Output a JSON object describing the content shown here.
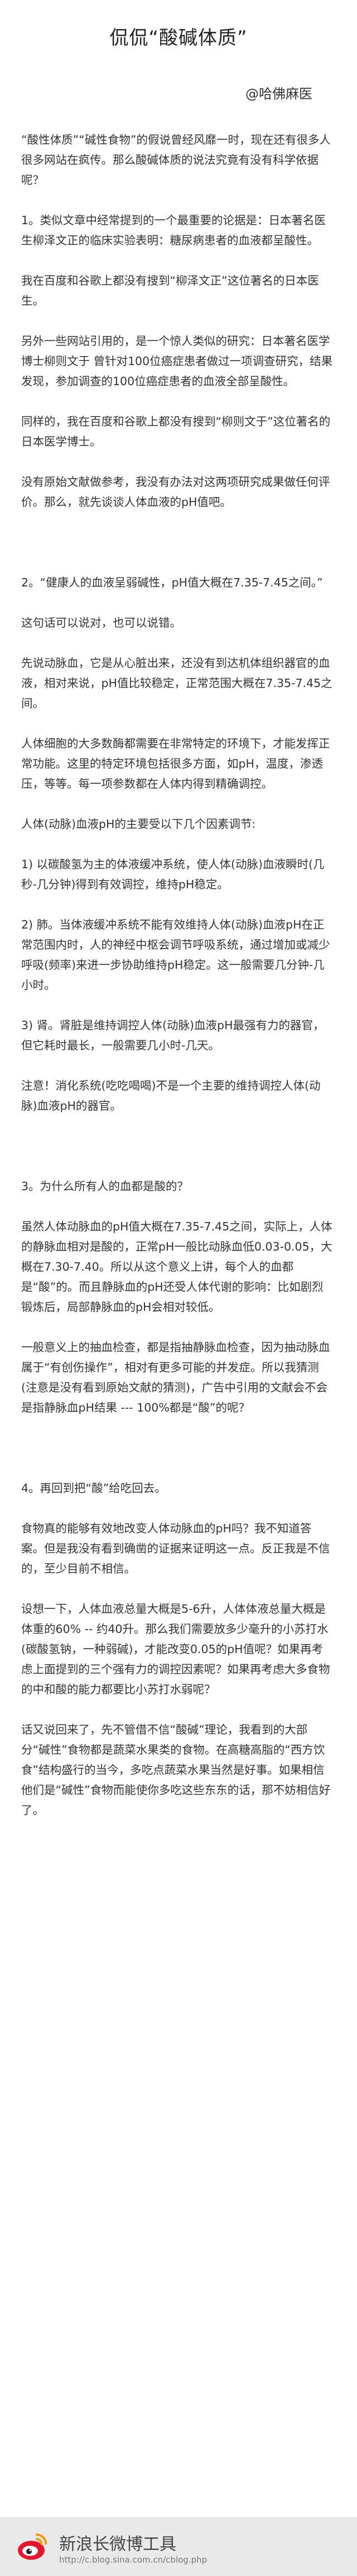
{
  "article": {
    "title": "侃侃“酸碱体质”",
    "author": "@哈佛麻医",
    "paragraphs": [
      "“酸性体质”“碱性食物”的假说曾经风靡一时，现在还有很多人很多网站在疯传。那么酸碱体质的说法究竟有没有科学依据呢？",
      "1。类似文章中经常提到的一个最重要的论据是：日本著名医生柳泽文正的临床实验表明：糖尿病患者的血液都呈酸性。",
      "我在百度和谷歌上都没有搜到“柳泽文正”这位著名的日本医生。",
      "另外一些网站引用的，是一个惊人类似的研究：日本著名医学博士柳则文于 曾针对100位癌症患者做过一项调查研究，结果发现，参加调查的100位癌症患者的血液全部呈酸性。",
      "同样的，我在百度和谷歌上都没有搜到“柳则文于”这位著名的日本医学博士。",
      "没有原始文献做参考，我没有办法对这两项研究成果做任何评价。那么，就先谈谈人体血液的pH值吧。",
      "2。“健康人的血液呈弱碱性，pH值大概在7.35-7.45之间。”",
      "这句话可以说对，也可以说错。",
      "先说动脉血，它是从心脏出来，还没有到达机体组织器官的血液，相对来说，pH值比较稳定，正常范围大概在7.35-7.45之间。",
      "人体细胞的大多数酶都需要在非常特定的环境下，才能发挥正常功能。这里的特定环境包括很多方面，如pH，温度，渗透压，等等。每一项参数都在人体内得到精确调控。",
      "人体(动脉)血液pH的主要受以下几个因素调节:",
      "1) 以碳酸氢为主的体液缓冲系统，使人体(动脉)血液瞬时(几秒-几分钟)得到有效调控，维持pH稳定。",
      "2) 肺。当体液缓冲系统不能有效维持人体(动脉)血液pH在正常范围内时，人的神经中枢会调节呼吸系统，通过增加或减少呼吸(频率)来进一步协助维持pH稳定。这一般需要几分钟-几小时。",
      "3) 肾。肾脏是维持调控人体(动脉)血液pH最强有力的器官，但它耗时最长，一般需要几小时-几天。",
      "注意！消化系统(吃吃喝喝)不是一个主要的维持调控人体(动脉)血液pH的器官。",
      "3。为什么所有人的血都是酸的？",
      "虽然人体动脉血的pH值大概在7.35-7.45之间，实际上，人体的静脉血相对是酸的，正常pH一般比动脉血低0.03-0.05，大概在7.30-7.40。所以从这个意义上讲，每个人的血都是“酸”的。而且静脉血的pH还受人体代谢的影响：比如剧烈锻炼后，局部静脉血的pH会相对较低。",
      "一般意义上的抽血检查，都是指抽静脉血检查，因为抽动脉血属于“有创伤操作”，相对有更多可能的并发症。所以我猜测(注意是没有看到原始文献的猜测)，广告中引用的文献会不会是指静脉血pH结果 --- 100%都是“酸”的呢？",
      "4。再回到把“酸”给吃回去。",
      "食物真的能够有效地改变人体动脉血的pH吗？我不知道答案。但是我没有看到确凿的证据来证明这一点。反正我是不信的，至少目前不相信。",
      "设想一下，人体血液总量大概是5-6升，人体体液总量大概是体重的60% -- 约40升。那么我们需要放多少毫升的小苏打水(碳酸氢钠，一种弱碱)，才能改变0.05的pH值呢？如果再考虑上面提到的三个强有力的调控因素呢？如果再考虑大多食物的中和酸的能力都要比小苏打水弱呢？",
      "话又说回来了，先不管借不信“酸碱”理论，我看到的大部分“碱性”食物都是蔬菜水果类的食物。在高糖高脂的“西方饮食”结构盛行的当今，多吃点蔬菜水果当然是好事。如果相信他们是“碱性”食物而能使你多吃这些东东的话，那不妨相信好了。"
    ]
  },
  "footer": {
    "title": "新浪长微博工具",
    "url": "http://c.blog.sina.com.cn/cblog.php"
  }
}
